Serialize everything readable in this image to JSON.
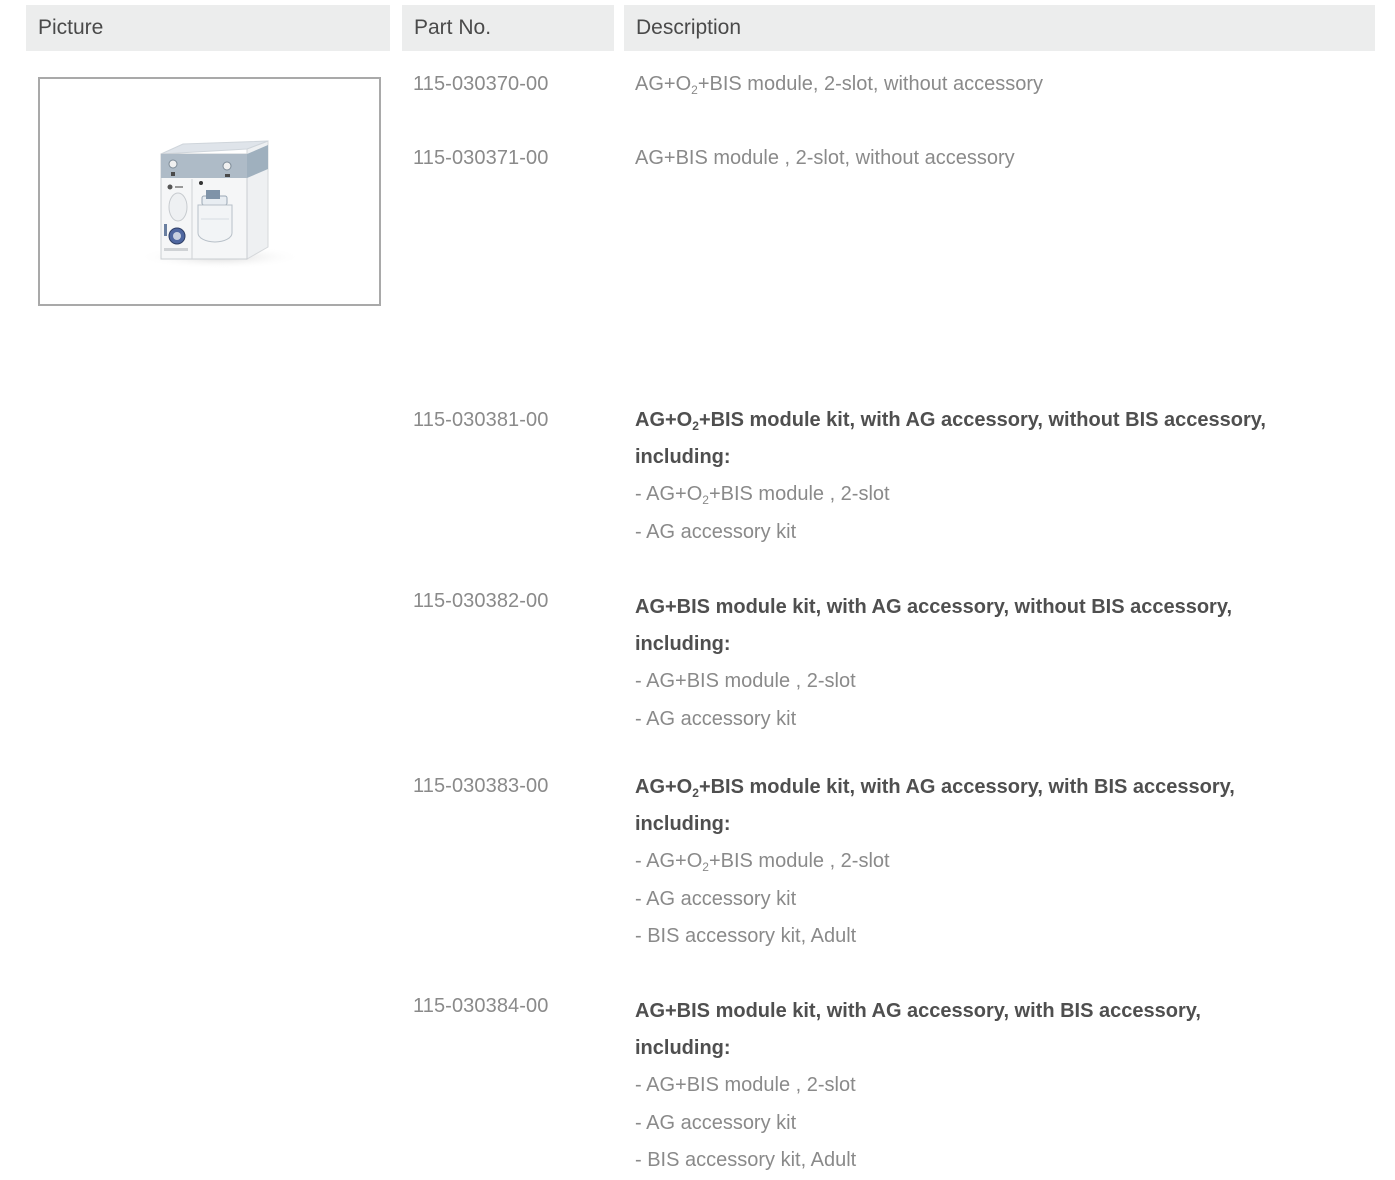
{
  "headers": {
    "picture": "Picture",
    "part_no": "Part No.",
    "description": "Description"
  },
  "rows": [
    {
      "part": "115-030370-00",
      "pre": "AG+O",
      "sub": "2",
      "post": "+BIS module, 2-slot, without accessory"
    },
    {
      "part": "115-030371-00",
      "text": "AG+BIS module , 2-slot, without accessory"
    }
  ],
  "kits": [
    {
      "part": "115-030381-00",
      "title_pre": "AG+O",
      "title_sub": "2",
      "title_post": "+BIS module kit, with AG accessory, without BIS accessory,",
      "title_line2": "including:",
      "item1_pre": "- AG+O",
      "item1_sub": "2",
      "item1_post": "+BIS module , 2-slot",
      "item2": "- AG accessory kit"
    },
    {
      "part": "115-030382-00",
      "title": "AG+BIS module kit, with AG accessory, without BIS accessory,",
      "title_line2": "including:",
      "item1": "- AG+BIS module , 2-slot",
      "item2": "- AG accessory kit"
    },
    {
      "part": "115-030383-00",
      "title_pre": "AG+O",
      "title_sub": "2",
      "title_post": "+BIS module kit, with AG accessory, with BIS accessory,",
      "title_line2": "including:",
      "item1_pre": "- AG+O",
      "item1_sub": "2",
      "item1_post": "+BIS module , 2-slot",
      "item2": "- AG accessory kit",
      "item3": "- BIS accessory kit, Adult"
    },
    {
      "part": "115-030384-00",
      "title": "AG+BIS module kit, with AG accessory, with BIS accessory,",
      "title_line2": "including:",
      "item1": "- AG+BIS module , 2-slot",
      "item2": "- AG accessory kit",
      "item3": "- BIS accessory kit, Adult"
    }
  ]
}
